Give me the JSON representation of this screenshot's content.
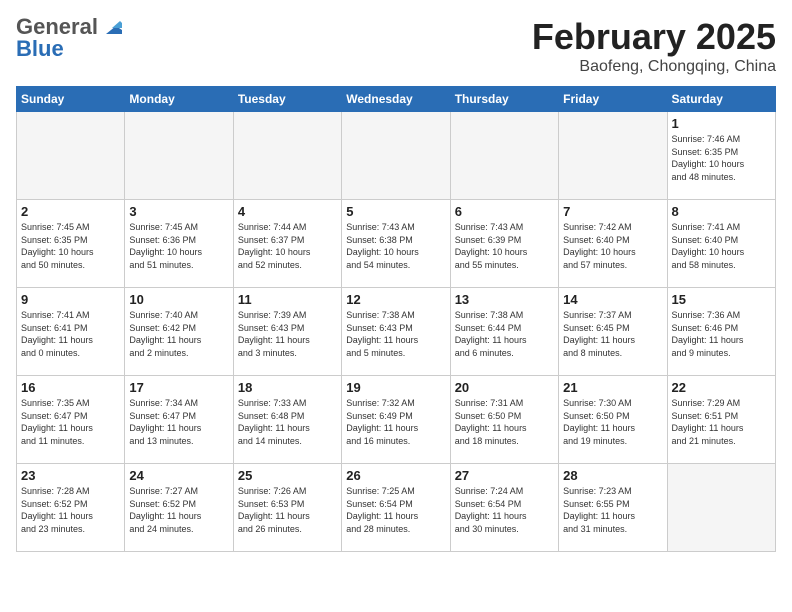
{
  "header": {
    "logo_general": "General",
    "logo_blue": "Blue",
    "title": "February 2025",
    "subtitle": "Baofeng, Chongqing, China"
  },
  "weekdays": [
    "Sunday",
    "Monday",
    "Tuesday",
    "Wednesday",
    "Thursday",
    "Friday",
    "Saturday"
  ],
  "weeks": [
    [
      {
        "day": "",
        "info": "",
        "empty": true
      },
      {
        "day": "",
        "info": "",
        "empty": true
      },
      {
        "day": "",
        "info": "",
        "empty": true
      },
      {
        "day": "",
        "info": "",
        "empty": true
      },
      {
        "day": "",
        "info": "",
        "empty": true
      },
      {
        "day": "",
        "info": "",
        "empty": true
      },
      {
        "day": "1",
        "info": "Sunrise: 7:46 AM\nSunset: 6:35 PM\nDaylight: 10 hours\nand 48 minutes.",
        "empty": false
      }
    ],
    [
      {
        "day": "2",
        "info": "Sunrise: 7:45 AM\nSunset: 6:35 PM\nDaylight: 10 hours\nand 50 minutes.",
        "empty": false
      },
      {
        "day": "3",
        "info": "Sunrise: 7:45 AM\nSunset: 6:36 PM\nDaylight: 10 hours\nand 51 minutes.",
        "empty": false
      },
      {
        "day": "4",
        "info": "Sunrise: 7:44 AM\nSunset: 6:37 PM\nDaylight: 10 hours\nand 52 minutes.",
        "empty": false
      },
      {
        "day": "5",
        "info": "Sunrise: 7:43 AM\nSunset: 6:38 PM\nDaylight: 10 hours\nand 54 minutes.",
        "empty": false
      },
      {
        "day": "6",
        "info": "Sunrise: 7:43 AM\nSunset: 6:39 PM\nDaylight: 10 hours\nand 55 minutes.",
        "empty": false
      },
      {
        "day": "7",
        "info": "Sunrise: 7:42 AM\nSunset: 6:40 PM\nDaylight: 10 hours\nand 57 minutes.",
        "empty": false
      },
      {
        "day": "8",
        "info": "Sunrise: 7:41 AM\nSunset: 6:40 PM\nDaylight: 10 hours\nand 58 minutes.",
        "empty": false
      }
    ],
    [
      {
        "day": "9",
        "info": "Sunrise: 7:41 AM\nSunset: 6:41 PM\nDaylight: 11 hours\nand 0 minutes.",
        "empty": false
      },
      {
        "day": "10",
        "info": "Sunrise: 7:40 AM\nSunset: 6:42 PM\nDaylight: 11 hours\nand 2 minutes.",
        "empty": false
      },
      {
        "day": "11",
        "info": "Sunrise: 7:39 AM\nSunset: 6:43 PM\nDaylight: 11 hours\nand 3 minutes.",
        "empty": false
      },
      {
        "day": "12",
        "info": "Sunrise: 7:38 AM\nSunset: 6:43 PM\nDaylight: 11 hours\nand 5 minutes.",
        "empty": false
      },
      {
        "day": "13",
        "info": "Sunrise: 7:38 AM\nSunset: 6:44 PM\nDaylight: 11 hours\nand 6 minutes.",
        "empty": false
      },
      {
        "day": "14",
        "info": "Sunrise: 7:37 AM\nSunset: 6:45 PM\nDaylight: 11 hours\nand 8 minutes.",
        "empty": false
      },
      {
        "day": "15",
        "info": "Sunrise: 7:36 AM\nSunset: 6:46 PM\nDaylight: 11 hours\nand 9 minutes.",
        "empty": false
      }
    ],
    [
      {
        "day": "16",
        "info": "Sunrise: 7:35 AM\nSunset: 6:47 PM\nDaylight: 11 hours\nand 11 minutes.",
        "empty": false
      },
      {
        "day": "17",
        "info": "Sunrise: 7:34 AM\nSunset: 6:47 PM\nDaylight: 11 hours\nand 13 minutes.",
        "empty": false
      },
      {
        "day": "18",
        "info": "Sunrise: 7:33 AM\nSunset: 6:48 PM\nDaylight: 11 hours\nand 14 minutes.",
        "empty": false
      },
      {
        "day": "19",
        "info": "Sunrise: 7:32 AM\nSunset: 6:49 PM\nDaylight: 11 hours\nand 16 minutes.",
        "empty": false
      },
      {
        "day": "20",
        "info": "Sunrise: 7:31 AM\nSunset: 6:50 PM\nDaylight: 11 hours\nand 18 minutes.",
        "empty": false
      },
      {
        "day": "21",
        "info": "Sunrise: 7:30 AM\nSunset: 6:50 PM\nDaylight: 11 hours\nand 19 minutes.",
        "empty": false
      },
      {
        "day": "22",
        "info": "Sunrise: 7:29 AM\nSunset: 6:51 PM\nDaylight: 11 hours\nand 21 minutes.",
        "empty": false
      }
    ],
    [
      {
        "day": "23",
        "info": "Sunrise: 7:28 AM\nSunset: 6:52 PM\nDaylight: 11 hours\nand 23 minutes.",
        "empty": false
      },
      {
        "day": "24",
        "info": "Sunrise: 7:27 AM\nSunset: 6:52 PM\nDaylight: 11 hours\nand 24 minutes.",
        "empty": false
      },
      {
        "day": "25",
        "info": "Sunrise: 7:26 AM\nSunset: 6:53 PM\nDaylight: 11 hours\nand 26 minutes.",
        "empty": false
      },
      {
        "day": "26",
        "info": "Sunrise: 7:25 AM\nSunset: 6:54 PM\nDaylight: 11 hours\nand 28 minutes.",
        "empty": false
      },
      {
        "day": "27",
        "info": "Sunrise: 7:24 AM\nSunset: 6:54 PM\nDaylight: 11 hours\nand 30 minutes.",
        "empty": false
      },
      {
        "day": "28",
        "info": "Sunrise: 7:23 AM\nSunset: 6:55 PM\nDaylight: 11 hours\nand 31 minutes.",
        "empty": false
      },
      {
        "day": "",
        "info": "",
        "empty": true
      }
    ]
  ]
}
